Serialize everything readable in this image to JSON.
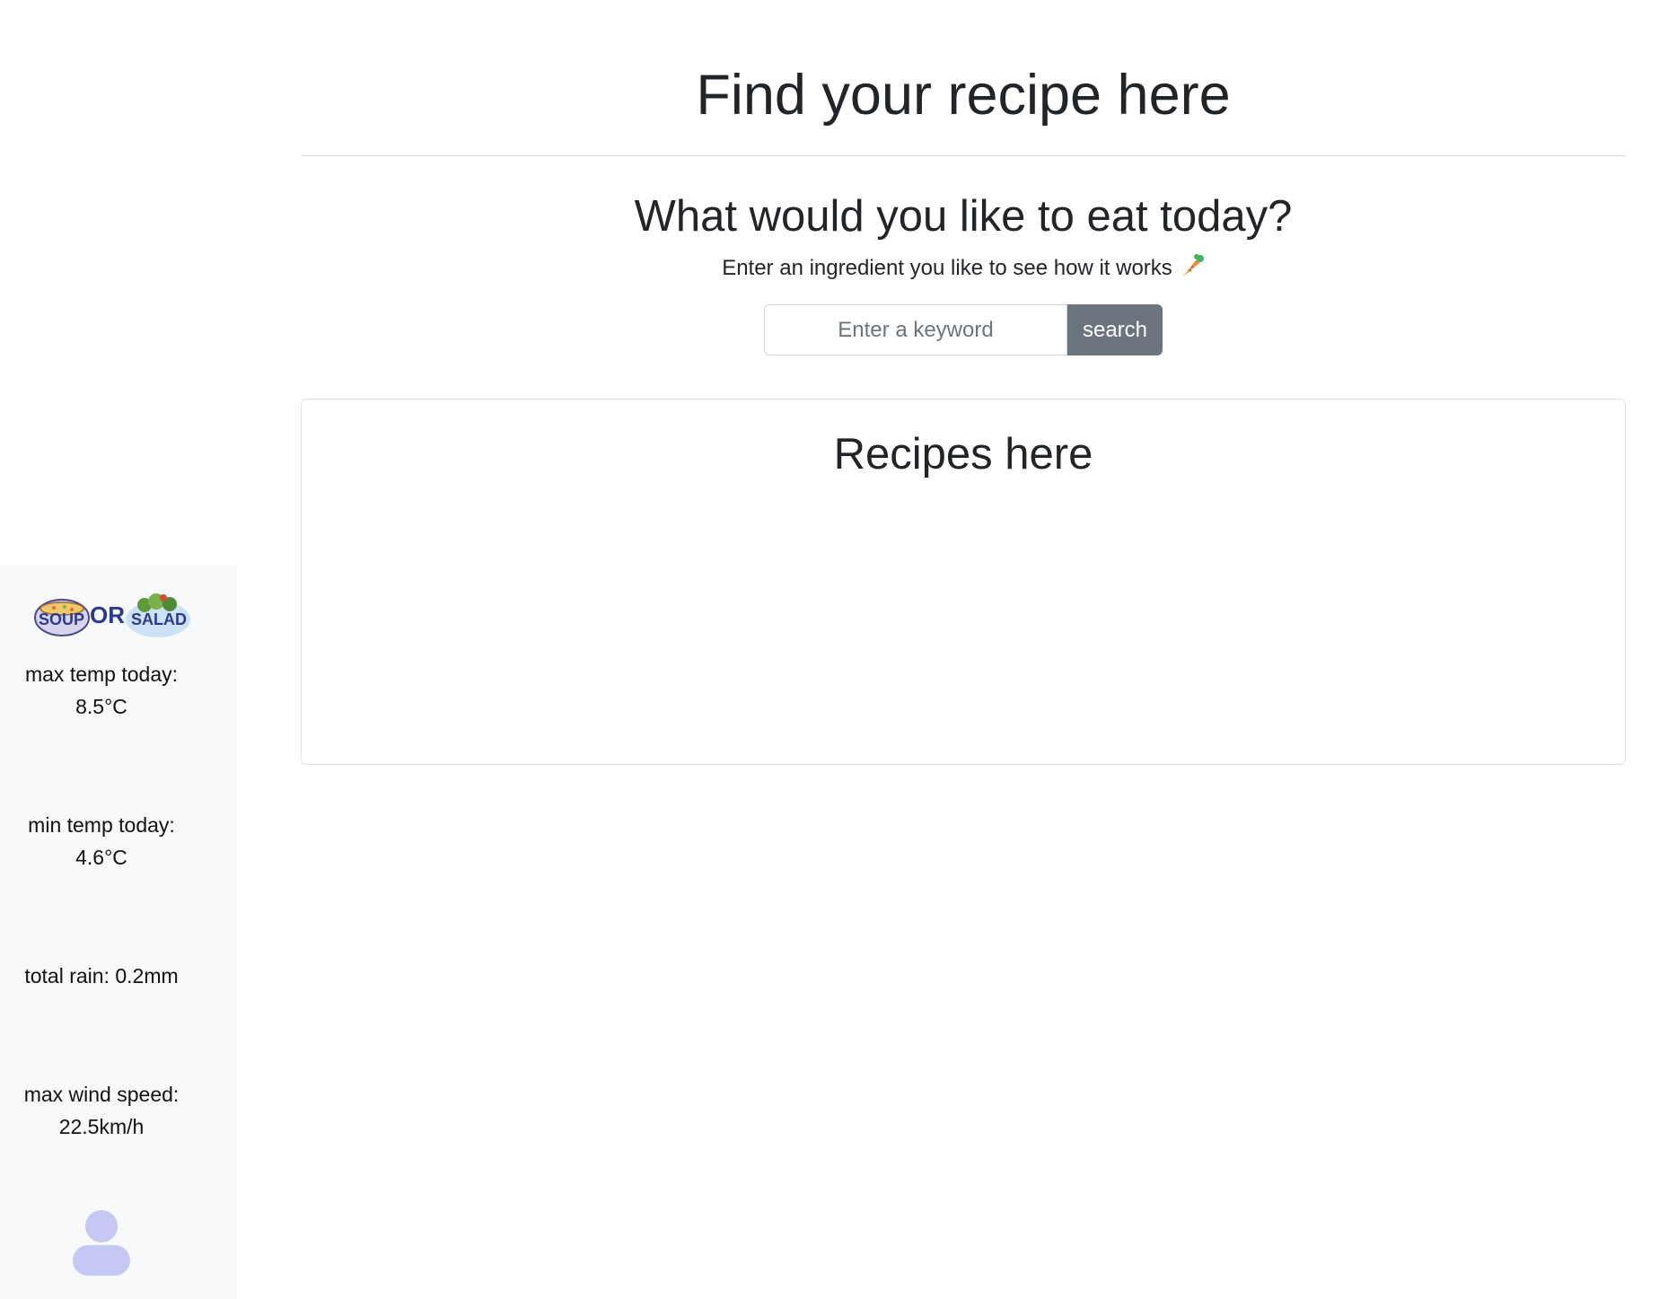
{
  "sidebar": {
    "logo": {
      "text_left": "SOUP",
      "text_mid": "OR",
      "text_right": "SALAD"
    },
    "weather": [
      {
        "label": "max temp today:",
        "value": "8.5°C"
      },
      {
        "label": "min temp today:",
        "value": "4.6°C"
      },
      {
        "label": "total rain: 0.2mm",
        "value": ""
      },
      {
        "label": "max wind speed:",
        "value": "22.5km/h"
      }
    ],
    "user_icon": "user-icon"
  },
  "main": {
    "title": "Find your recipe here",
    "subtitle": "What would you like to eat today?",
    "hint": "Enter an ingredient you like to see how it works",
    "hint_icon": "carrot-icon",
    "search": {
      "placeholder": "Enter a keyword",
      "value": "",
      "button_label": "search"
    },
    "recipes": {
      "title": "Recipes here"
    }
  },
  "colors": {
    "sidebar_bg": "#f8f9fa",
    "button_bg": "#6c757d",
    "logo_blue": "#2b3a8f",
    "user_icon": "#c5c8f2",
    "carrot": "#f28a2e"
  }
}
